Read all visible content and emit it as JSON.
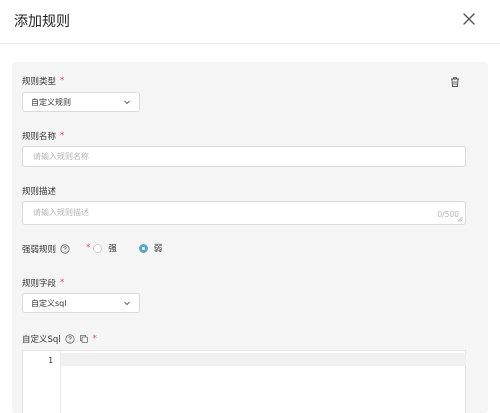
{
  "dialog": {
    "title": "添加规则"
  },
  "form": {
    "required_mark": "*",
    "rule_type": {
      "label": "规则类型",
      "value": "自定义规则"
    },
    "rule_name": {
      "label": "规则名称",
      "placeholder": "请输入规则名称"
    },
    "rule_desc": {
      "label": "规则描述",
      "placeholder": "请输入规则描述",
      "counter": "0/500"
    },
    "strength": {
      "label": "强弱规则",
      "options": [
        "强",
        "弱"
      ],
      "selected": "弱"
    },
    "rule_field": {
      "label": "规则字段",
      "value": "自定义sql"
    },
    "custom_sql": {
      "label": "自定义Sql",
      "line_numbers": [
        "1"
      ]
    }
  },
  "icons": {
    "close": "close-icon",
    "delete": "trash-icon",
    "help": "question-circle-icon",
    "copy": "copy-icon",
    "dropdown": "chevron-down-icon"
  },
  "colors": {
    "required": "#e34d59",
    "radio_selected": "#5aa9c7",
    "panel_bg": "#f5f5f6"
  }
}
